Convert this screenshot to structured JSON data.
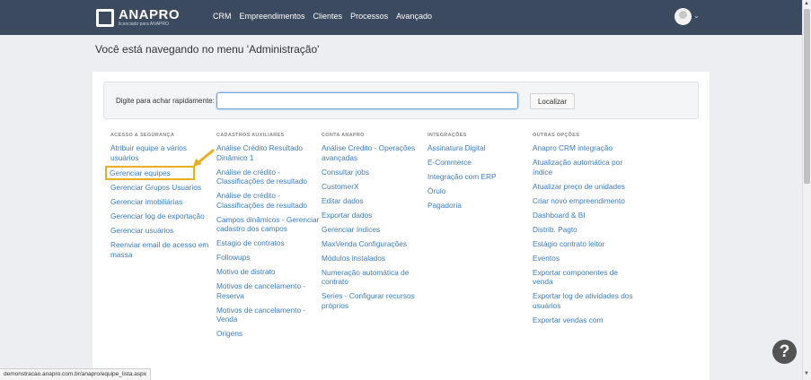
{
  "brand": {
    "name": "ANAPRO",
    "tagline": "licenciado para ANAPRO"
  },
  "nav": [
    {
      "label": "CRM"
    },
    {
      "label": "Empreendimentos"
    },
    {
      "label": "Clientes"
    },
    {
      "label": "Processos"
    },
    {
      "label": "Avançado"
    }
  ],
  "page": {
    "heading": "Você está navegando no menu 'Administração'"
  },
  "search": {
    "label": "Digite para achar rapidamente:",
    "value": "",
    "button": "Localizar"
  },
  "columns": [
    {
      "title": "ACESSO & SEGURANÇA",
      "items": [
        "Atribuir equipe a vários usuários",
        "Gerenciar equipes",
        "Gerenciar Grupos Usuarios",
        "Gerenciar imobiliárias",
        "Gerenciar log de exportação",
        "Gerenciar usuários",
        "Reenviar email de acesso em massa"
      ]
    },
    {
      "title": "CADASTROS AUXILIARES",
      "items": [
        "Análise Crédito Resultado Dinâmico 1",
        "Análise de crédito - Classificações de resultado",
        "Análise de crédito - Classificações de resultado",
        "Campos dinâmicos - Gerenciar cadastro dos campos",
        "Estagio de contratos",
        "Followups",
        "Motivo de distrato",
        "Motivos de cancelamento - Reserva",
        "Motivos de cancelamento - Venda",
        "Origens"
      ]
    },
    {
      "title": "CONTA ANAPRO",
      "items": [
        "Análise Credito - Operações avançadas",
        "Consultar jobs",
        "CustomerX",
        "Editar dados",
        "Exportar dados",
        "Gerenciar índices",
        "MaxVenda Configurações",
        "Módulos instalados",
        "Numeração automática de contrato",
        "Series - Configurar recursos próprios"
      ]
    },
    {
      "title": "INTEGRAÇÕES",
      "items": [
        "Assinatura Digital",
        "E-Commerce",
        "Integração com ERP",
        "Órulo",
        "Pagadoria"
      ]
    },
    {
      "title": "OUTRAS OPÇÕES",
      "items": [
        "Anapro CRM integração",
        "Atualização automática por índice",
        "Atualizar preço de unidades",
        "Criar novo empreendimento",
        "Dashboard & BI",
        "Distrib. Pagto",
        "Estágio contrato leitor",
        "Eventos",
        "Exportar componentes de venda",
        "Exportar log de atividades dos usuários",
        "Exportar vendas com"
      ]
    }
  ],
  "help": {
    "label": "?"
  },
  "status_url": "demonstracao.anapro.com.br/anapro/equipe_lista.aspx",
  "colors": {
    "topbar": "#3b4a5e",
    "link": "#3a7cc4",
    "highlight": "#e8b020"
  }
}
